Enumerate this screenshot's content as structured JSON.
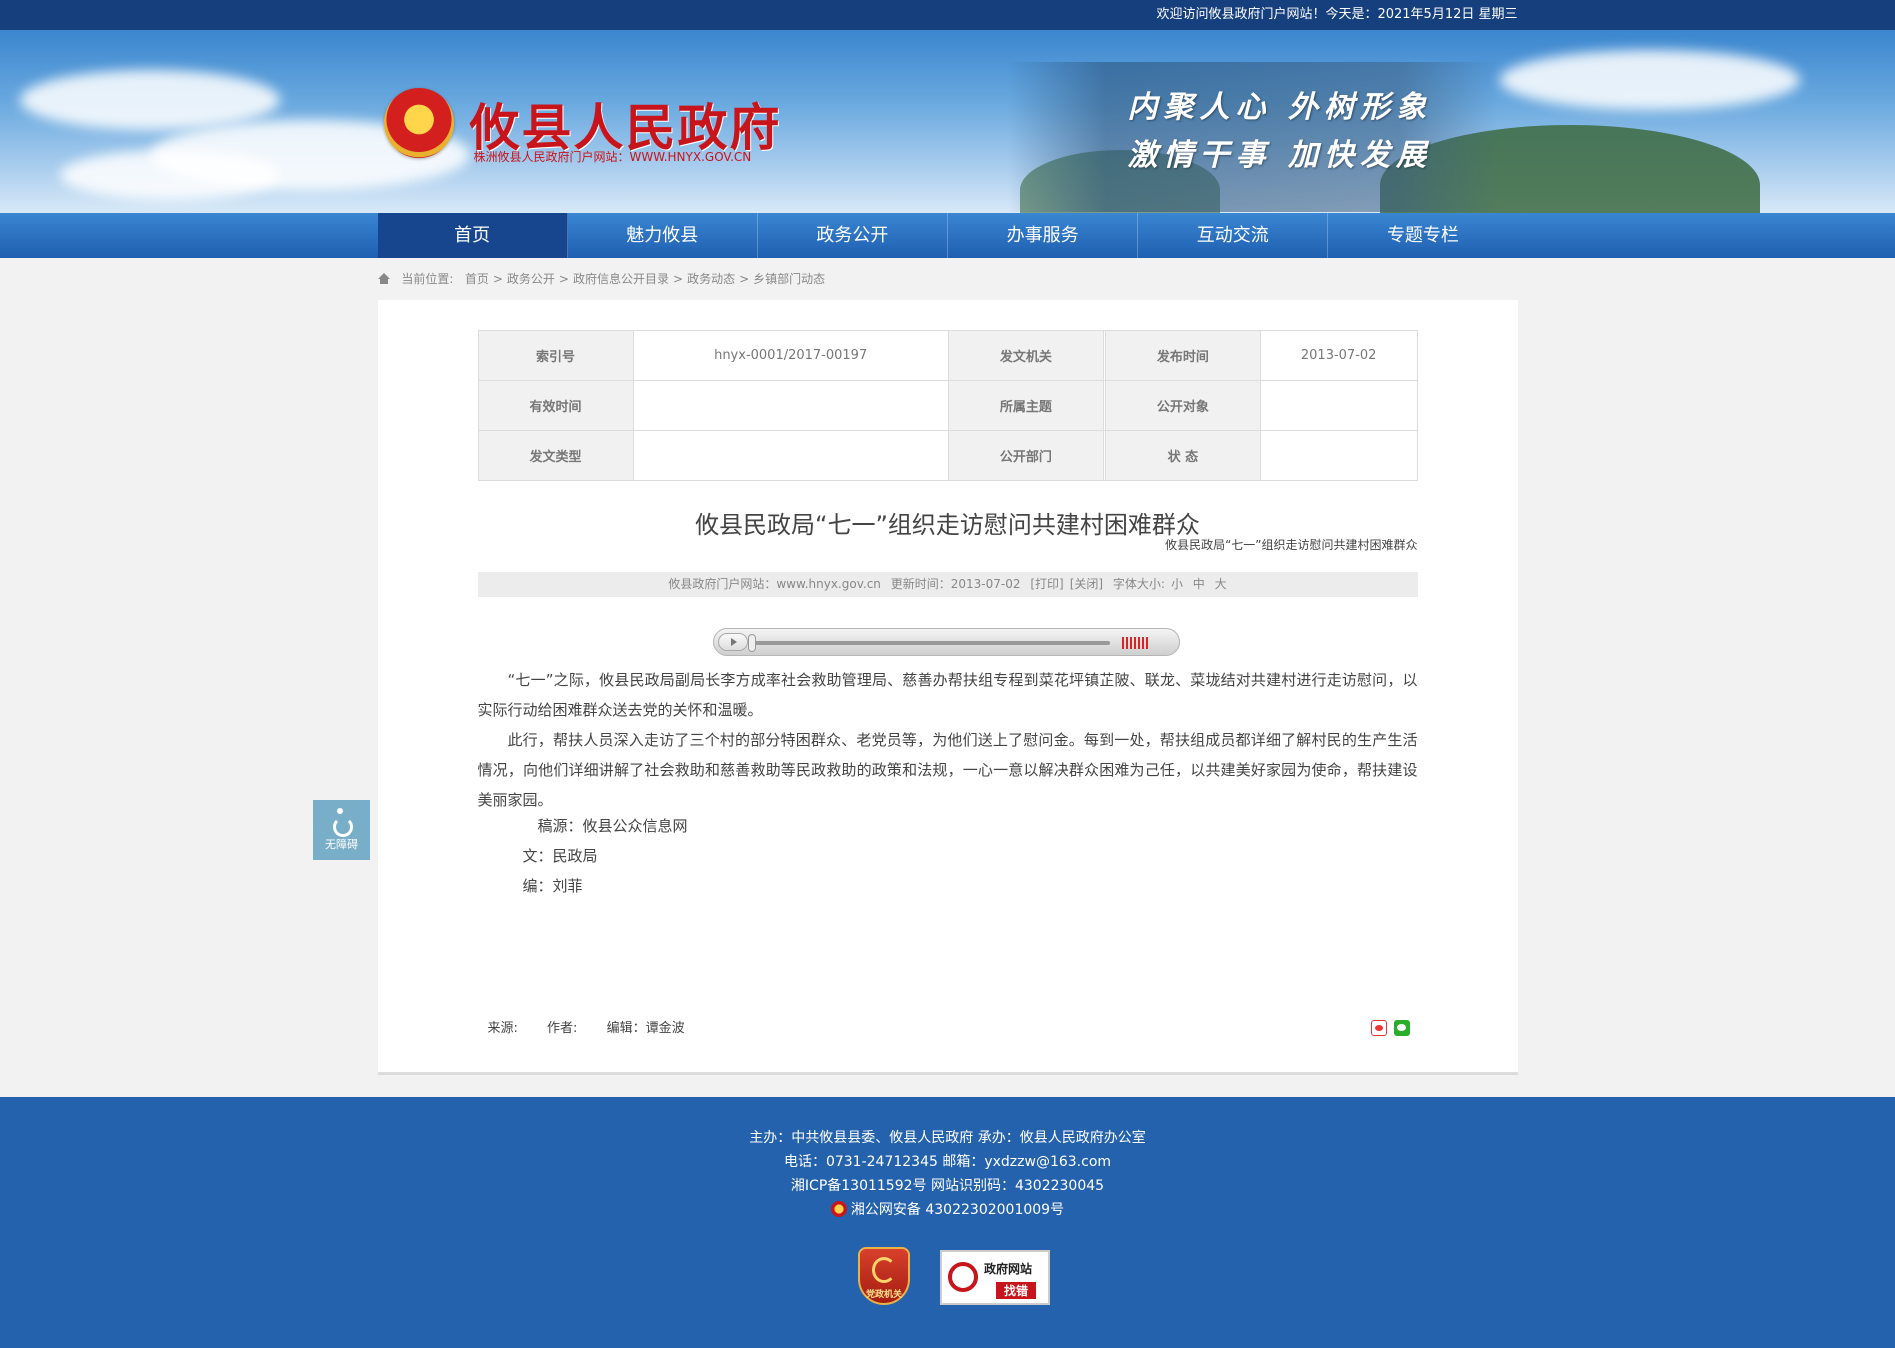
{
  "topbar": {
    "welcome": "欢迎访问攸县政府门户网站！今天是：2021年5月12日 星期三"
  },
  "header": {
    "site_title": "攸县人民政府",
    "site_subtitle": "株洲攸县人民政府门户网站：WWW.HNYX.GOV.CN",
    "slogan_line1": "内聚人心  外树形象",
    "slogan_line2": "激情干事  加快发展"
  },
  "nav": {
    "items": [
      {
        "label": "首页"
      },
      {
        "label": "魅力攸县"
      },
      {
        "label": "政务公开"
      },
      {
        "label": "办事服务"
      },
      {
        "label": "互动交流"
      },
      {
        "label": "专题专栏"
      }
    ]
  },
  "breadcrumb": {
    "prefix": "当前位置:",
    "items": [
      "首页",
      "政务公开",
      "政府信息公开目录",
      "政务动态",
      "乡镇部门动态"
    ],
    "separator": ">"
  },
  "meta_table": {
    "rows": [
      [
        {
          "k": "索引号",
          "v": "hnyx-0001/2017-00197"
        },
        {
          "k": "发文机关",
          "v": ""
        },
        {
          "k": "发布时间",
          "v": "2013-07-02"
        }
      ],
      [
        {
          "k": "有效时间",
          "v": ""
        },
        {
          "k": "所属主题",
          "v": ""
        },
        {
          "k": "公开对象",
          "v": ""
        }
      ],
      [
        {
          "k": "发文类型",
          "v": ""
        },
        {
          "k": "公开部门",
          "v": ""
        },
        {
          "k": "状 态",
          "v": ""
        }
      ]
    ]
  },
  "article": {
    "title": "攸县民政局“七一”组织走访慰问共建村困难群众",
    "subtitle": "攸县民政局“七一”组织走访慰问共建村困难群众",
    "info": {
      "site": "攸县政府门户网站：www.hnyx.gov.cn",
      "updated": "更新时间：2013-07-02",
      "print": "[打印]",
      "close": "[关闭]",
      "font_label": "字体大小:",
      "font_small": "小",
      "font_medium": "中",
      "font_large": "大"
    },
    "paragraphs": [
      "“七一”之际，攸县民政局副局长李方成率社会救助管理局、慈善办帮扶组专程到菜花坪镇芷陂、联龙、菜垅结对共建村进行走访慰问，以实际行动给困难群众送去党的关怀和温暖。",
      "此行，帮扶人员深入走访了三个村的部分特困群众、老党员等，为他们送上了慰问金。每到一处，帮扶组成员都详细了解村民的生产生活情况，向他们详细讲解了社会救助和慈善救助等民政救助的政策和法规，一心一意以解决群众困难为己任，以共建美好家园为使命，帮扶建设美丽家园。"
    ],
    "credits": {
      "source": "稿源：攸县公众信息网",
      "text": "文：民政局",
      "editor": "编：刘菲"
    },
    "footer_meta": {
      "source": "来源:",
      "author": "作者:",
      "editor": "编辑：谭金波"
    }
  },
  "accessibility": {
    "label": "无障碍"
  },
  "footer": {
    "line1": "主办：中共攸县县委、攸县人民政府 承办：攸县人民政府办公室",
    "line2": "电话：0731-24712345 邮箱：yxdzzw@163.com",
    "line3": "湘ICP备13011592号    网站识别码：4302230045",
    "line4": "湘公网安备 43022302001009号",
    "badge_party": "党政机关",
    "badge_error_1": "政府网站",
    "badge_error_2": "找错"
  }
}
